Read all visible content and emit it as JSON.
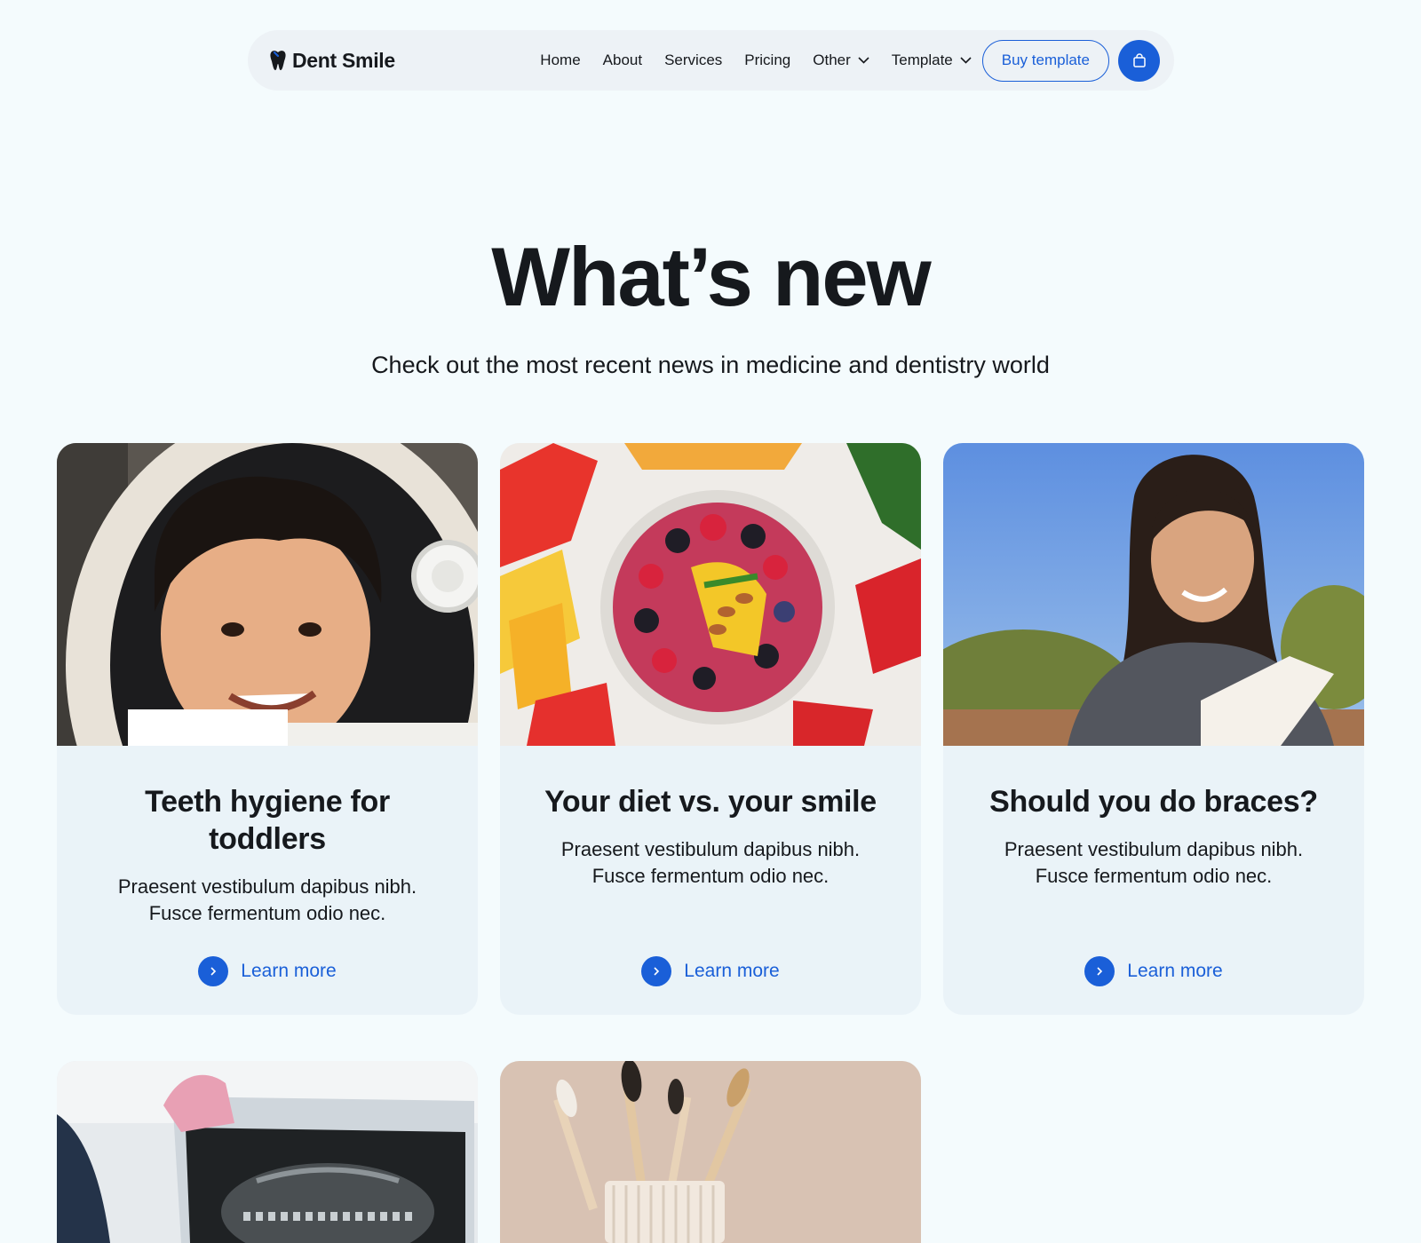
{
  "nav": {
    "brand": "Dent Smile",
    "links": [
      "Home",
      "About",
      "Services",
      "Pricing",
      "Other",
      "Template"
    ],
    "buy_label": "Buy template",
    "cart_icon": "shopping-bag-icon",
    "accent": "#1a5fd8"
  },
  "hero": {
    "title": "What’s new",
    "subtitle": "Check out the most recent news in medicine and dentistry world"
  },
  "cards": [
    {
      "image": "child-astronaut-helmet-photo",
      "title": "Teeth hygiene for toddlers",
      "text": "Praesent vestibulum dapibus nibh. Fusce fermentum odio nec.",
      "link": "Learn more"
    },
    {
      "image": "fruit-smoothie-bowl-photo",
      "title": "Your diet vs. your smile",
      "text": "Praesent vestibulum dapibus nibh. Fusce fermentum odio nec.",
      "link": "Learn more"
    },
    {
      "image": "smiling-woman-reading-photo",
      "title": "Should you do braces?",
      "text": "Praesent vestibulum dapibus nibh. Fusce fermentum odio nec.",
      "link": "Learn more"
    },
    {
      "image": "dental-xray-photo"
    },
    {
      "image": "bamboo-toothbrushes-photo"
    }
  ]
}
